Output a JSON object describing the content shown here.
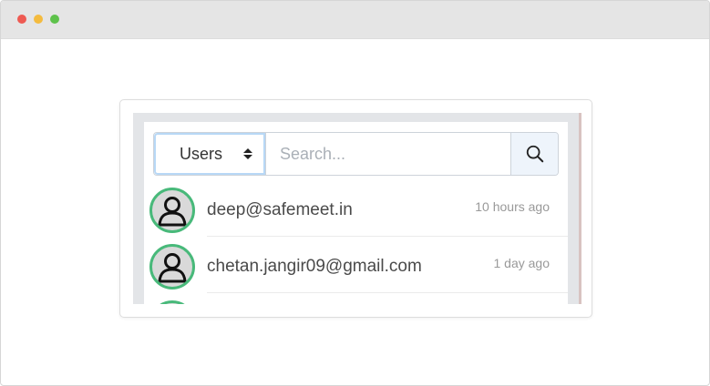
{
  "search": {
    "filter_value": "Users",
    "placeholder": "Search...",
    "button_icon": "search-icon"
  },
  "users": [
    {
      "email": "deep@safemeet.in",
      "time": "10 hours ago",
      "avatar_icon": "user-icon"
    },
    {
      "email": "chetan.jangir09@gmail.com",
      "time": "1 day ago",
      "avatar_icon": "user-icon"
    }
  ],
  "colors": {
    "avatar_ring": "#48b97a",
    "avatar_bg": "#d9d9d9",
    "focus_ring": "#b8d8f6",
    "search_button_bg": "#eef4fb"
  }
}
